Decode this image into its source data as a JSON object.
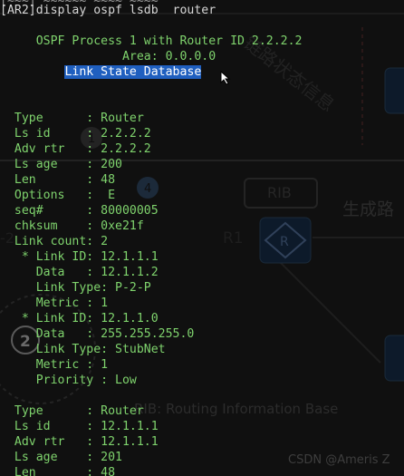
{
  "terminal": {
    "lines": {
      "l00": "[~~~] ~~~~~~ ~~~~ ~~~~",
      "l01": "[AR2]display ospf lsdb  router",
      "l02": "     OSPF Process 1 with Router ID 2.2.2.2",
      "l03": "                 Area: 0.0.0.0",
      "l04": "         Link State Database",
      "l05": "  Type      : Router",
      "l06": "  Ls id     : 2.2.2.2",
      "l07": "  Adv rtr   : 2.2.2.2",
      "l08": "  Ls age    : 200",
      "l09": "  Len       : 48",
      "l10": "  Options   :  E",
      "l11": "  seq#      : 80000005",
      "l12": "  chksum    : 0xe21f",
      "l13": "  Link count: 2",
      "l14": "   * Link ID: 12.1.1.1",
      "l15": "     Data   : 12.1.1.2",
      "l16": "     Link Type: P-2-P",
      "l17": "     Metric : 1",
      "l18": "   * Link ID: 12.1.1.0",
      "l19": "     Data   : 255.255.255.0",
      "l20": "     Link Type: StubNet",
      "l21": "     Metric : 1",
      "l22": "     Priority : Low",
      "l23": "  Type      : Router",
      "l24": "  Ls id     : 12.1.1.1",
      "l25": "  Adv rtr   : 12.1.1.1",
      "l26": "  Ls age    : 201",
      "l27": "  Len       : 48"
    }
  },
  "background": {
    "cn_diag": "链路状态信息",
    "cn_right": "生成路",
    "rib_label": "RIB",
    "r1_label": "R1",
    "s2_label": "-2",
    "rib_desc": "RIB: Routing Information Base",
    "num_1": "1",
    "num_2": "2",
    "num_4": "4",
    "router_glyph": "R",
    "watermark": "CSDN @Ameris Z"
  },
  "colors": {
    "terminal_bg": "#101010",
    "terminal_text": "#d6d6d6",
    "accent_green": "#7fd36d",
    "selection": "#1f5fbf"
  }
}
